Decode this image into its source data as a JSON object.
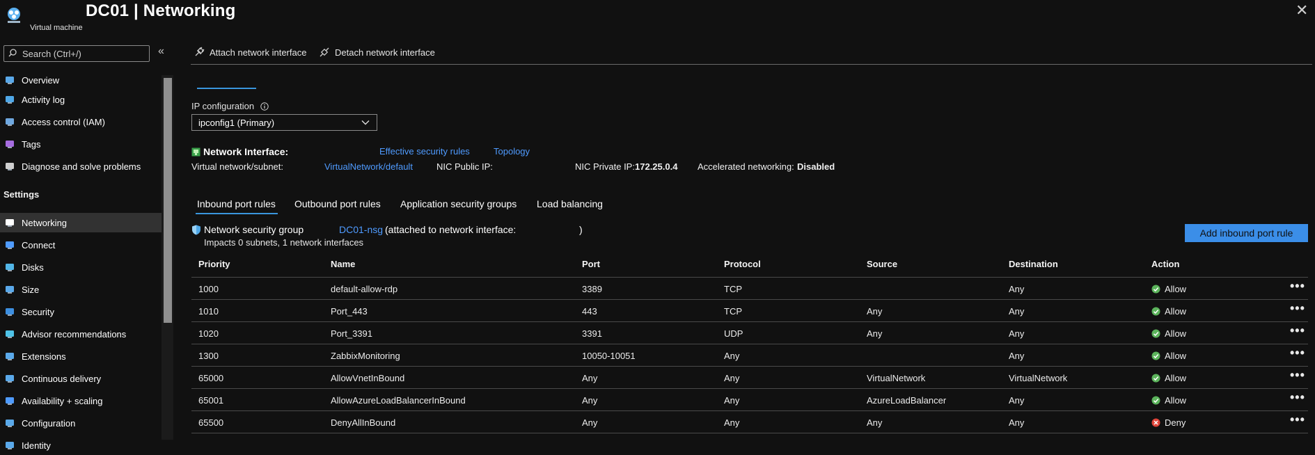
{
  "header": {
    "title": "DC01 | Networking",
    "subtitle": "Virtual machine",
    "close_symbol": "✕"
  },
  "search": {
    "placeholder": "Search (Ctrl+/)"
  },
  "sidebar": {
    "collapse_symbol": "«",
    "settings_heading": "Settings",
    "items": [
      {
        "label": "Overview",
        "icon": "monitor-icon"
      },
      {
        "label": "Activity log",
        "icon": "log-icon"
      },
      {
        "label": "Access control (IAM)",
        "icon": "people-icon"
      },
      {
        "label": "Tags",
        "icon": "tag-icon"
      },
      {
        "label": "Diagnose and solve problems",
        "icon": "wrench-icon"
      },
      {
        "label": "Networking",
        "icon": "network-icon"
      },
      {
        "label": "Connect",
        "icon": "connect-icon"
      },
      {
        "label": "Disks",
        "icon": "disk-icon"
      },
      {
        "label": "Size",
        "icon": "monitor-icon"
      },
      {
        "label": "Security",
        "icon": "shield-icon"
      },
      {
        "label": "Advisor recommendations",
        "icon": "advisor-icon"
      },
      {
        "label": "Extensions",
        "icon": "extensions-icon"
      },
      {
        "label": "Continuous delivery",
        "icon": "delivery-icon"
      },
      {
        "label": "Availability + scaling",
        "icon": "scaling-icon"
      },
      {
        "label": "Configuration",
        "icon": "configuration-icon"
      },
      {
        "label": "Identity",
        "icon": "identity-icon"
      }
    ]
  },
  "toolbar": {
    "attach_label": "Attach network interface",
    "detach_label": "Detach network interface"
  },
  "ipconfig": {
    "label": "IP configuration",
    "selected": "ipconfig1 (Primary)"
  },
  "nic": {
    "label": "Network Interface:",
    "effective_rules_link": "Effective security rules",
    "topology_link": "Topology",
    "vnet_label": "Virtual network/subnet:",
    "vnet_value": "VirtualNetwork/default",
    "public_ip_label": "NIC Public IP:",
    "private_ip_label": "NIC Private IP:",
    "private_ip_value": "172.25.0.4",
    "accel_label": "Accelerated networking:",
    "accel_value": "Disabled"
  },
  "rule_tabs": [
    "Inbound port rules",
    "Outbound port rules",
    "Application security groups",
    "Load balancing"
  ],
  "nsg": {
    "label": "Network security group",
    "name_link": "DC01-nsg",
    "attached_text": "(attached to network interface:",
    "closing_paren": ")",
    "impacts": "Impacts 0 subnets, 1 network interfaces",
    "add_button": "Add inbound port rule"
  },
  "table": {
    "headers": [
      "Priority",
      "Name",
      "Port",
      "Protocol",
      "Source",
      "Destination",
      "Action"
    ],
    "rows": [
      {
        "priority": "1000",
        "name": "default-allow-rdp",
        "port": "3389",
        "protocol": "TCP",
        "source": "",
        "destination": "Any",
        "action": "Allow"
      },
      {
        "priority": "1010",
        "name": "Port_443",
        "port": "443",
        "protocol": "TCP",
        "source": "Any",
        "destination": "Any",
        "action": "Allow"
      },
      {
        "priority": "1020",
        "name": "Port_3391",
        "port": "3391",
        "protocol": "UDP",
        "source": "Any",
        "destination": "Any",
        "action": "Allow"
      },
      {
        "priority": "1300",
        "name": "ZabbixMonitoring",
        "port": "10050-10051",
        "protocol": "Any",
        "source": "",
        "destination": "Any",
        "action": "Allow"
      },
      {
        "priority": "65000",
        "name": "AllowVnetInBound",
        "port": "Any",
        "protocol": "Any",
        "source": "VirtualNetwork",
        "destination": "VirtualNetwork",
        "action": "Allow"
      },
      {
        "priority": "65001",
        "name": "AllowAzureLoadBalancerInBound",
        "port": "Any",
        "protocol": "Any",
        "source": "AzureLoadBalancer",
        "destination": "Any",
        "action": "Allow"
      },
      {
        "priority": "65500",
        "name": "DenyAllInBound",
        "port": "Any",
        "protocol": "Any",
        "source": "Any",
        "destination": "Any",
        "action": "Deny"
      }
    ],
    "more_symbol": "•••"
  },
  "colors": {
    "accent": "#3a96dd",
    "link": "#4f9bff",
    "allow": "#5bb35b",
    "deny": "#e0453a"
  }
}
